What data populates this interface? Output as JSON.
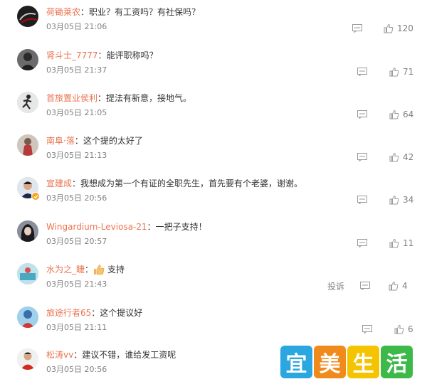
{
  "comments": [
    {
      "username": "荷锄莱农",
      "text": "职业？有工资吗？有社保吗？",
      "time": "03月05日 21:06",
      "likes": "120",
      "avatar": "dark-abstract"
    },
    {
      "username": "肾斗士_7777",
      "text": "能评职称吗？",
      "time": "03月05日 21:37",
      "likes": "71",
      "avatar": "person-dark"
    },
    {
      "username": "首旅置业侯利",
      "text": "提法有新意，接地气。",
      "time": "03月05日 21:05",
      "likes": "64",
      "avatar": "runner"
    },
    {
      "username": "南阜·落",
      "text": "这个提的太好了",
      "time": "03月05日 21:13",
      "likes": "42",
      "avatar": "person-red"
    },
    {
      "username": "宣建成",
      "text": "我想成为第一个有证的全职先生，首先要有个老婆，谢谢。",
      "time": "03月05日 20:56",
      "likes": "34",
      "avatar": "man-portrait",
      "verified": true
    },
    {
      "username": "Wingardium-Leviosa-21",
      "text": "一把子支持！",
      "time": "03月05日 20:57",
      "likes": "11",
      "avatar": "dark-hair"
    },
    {
      "username": "水为之_睫",
      "text": "支持",
      "time": "03月05日 21:43",
      "likes": "4",
      "avatar": "teal-scene",
      "emoji": "thumbs-up-emoji",
      "report": "投诉"
    },
    {
      "username": "旅途行者65",
      "text": "这个提议好",
      "time": "03月05日 21:11",
      "likes": "6",
      "avatar": "blue-character"
    },
    {
      "username": "松涛vv",
      "text": "建议不错，谁给发工资呢",
      "time": "03月05日 20:56",
      "likes": "",
      "avatar": "man-red-shirt"
    }
  ],
  "separator": "：",
  "watermark": {
    "chars": [
      "宜",
      "美",
      "生",
      "活"
    ],
    "colors": [
      "#2aa7e0",
      "#f08a1c",
      "#f5c400",
      "#3db94a"
    ]
  },
  "colors": {
    "username": "#eb7350",
    "meta": "#808080"
  }
}
